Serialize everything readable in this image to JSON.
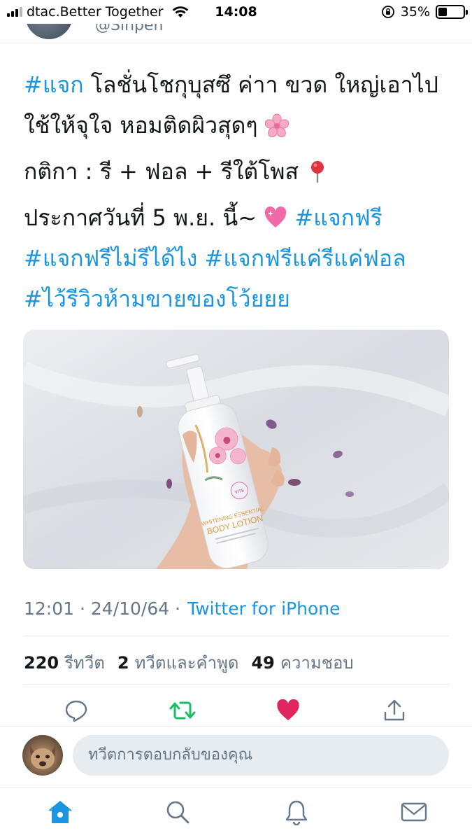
{
  "status_bar": {
    "carrier": "dtac.Better Together",
    "time": "14:08",
    "battery": "35%",
    "battery_level": 0.35
  },
  "header": {
    "handle_peek": "@Sinpen"
  },
  "tweet": {
    "line1_hashtag": "#แจก",
    "line1_text": " โลชั่นโชกุบุสซึ ค่าา ขวด ใหญ่เอาไปใช้ให้จุใจ หอมติดผิวสุดๆ ",
    "line1_emoji": "cherry-blossom-emoji",
    "line2_text": "กติกา : รี + ฟอล + รีใต้โพส ",
    "line2_emoji": "round-pushpin-emoji",
    "line3_text": "ประกาศวันที่ 5 พ.ย. นี้~ ",
    "line3_emoji": "sparkling-heart-emoji",
    "hashtags": [
      "#แจกฟรี",
      "#แจกฟรีไม่รีได้ไง",
      "#แจกฟรีแค่รีแค่ฟอล",
      "#ไว้รีวิวห้ามขายของโว้ยยย"
    ]
  },
  "photo": {
    "product_text": "BODY LOTION",
    "product_sub": "WHITENING ESSENTIAL"
  },
  "meta": {
    "timestamp": "12:01 · 24/10/64 ·",
    "source": "Twitter for iPhone"
  },
  "stats": {
    "retweets": "220",
    "retweets_label": "รีทวีต",
    "quotes": "2",
    "quotes_label": "ทวีตและคำพูด",
    "likes": "49",
    "likes_label": "ความชอบ"
  },
  "composer": {
    "placeholder": "ทวีตการตอบกลับของคุณ"
  },
  "colors": {
    "link": "#1b95e0",
    "retweet": "#17bf63",
    "like": "#e0245e",
    "muted": "#657786"
  }
}
